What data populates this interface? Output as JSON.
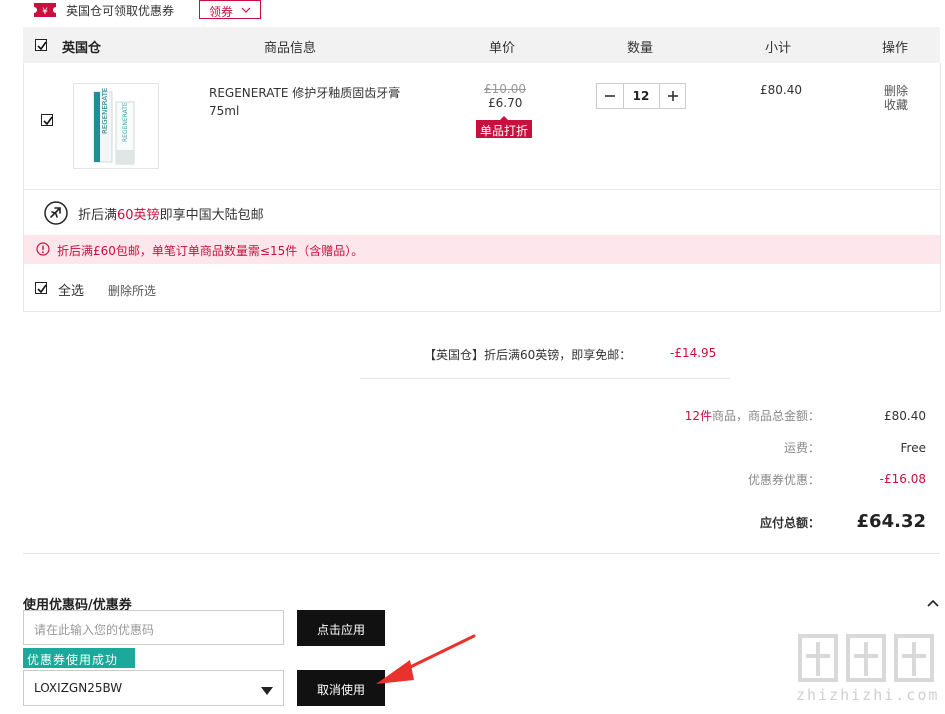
{
  "coupon_bar": {
    "text": "英国仓可领取优惠券",
    "claim_label": "领券",
    "chevron": "chevron-down-icon"
  },
  "table_header": {
    "warehouse": "英国仓",
    "columns": [
      "商品信息",
      "单价",
      "数量",
      "小计",
      "操作"
    ]
  },
  "item": {
    "name": "REGENERATE 修护牙釉质固齿牙膏 75ml",
    "original_price": "£10.00",
    "price": "£6.70",
    "discount_badge": "单品打折",
    "quantity": "12",
    "subtotal": "£80.40",
    "action_delete": "删除",
    "action_favorite": "收藏"
  },
  "shipping_promo": {
    "prefix": "折后满",
    "amount": "60英镑",
    "suffix": "即享中国大陆包邮"
  },
  "warning": "折后满£60包邮，单笔订单商品数量需≤15件（含赠品）。",
  "footer_actions": {
    "select_all": "全选",
    "delete_selected": "删除所选"
  },
  "discount_line": {
    "label": "【英国仓】折后满60英镑，即享免邮：",
    "value": "-£14.95"
  },
  "summary": {
    "count": "12件",
    "goods_label": "商品，商品总金额：",
    "goods_total": "£80.40",
    "shipping_label": "运费：",
    "shipping_value": "Free",
    "coupon_label": "优惠券优惠：",
    "coupon_value": "-£16.08",
    "payable_label": "应付总额：",
    "payable_value": "£64.32"
  },
  "coupon_section": {
    "title": "使用优惠码/优惠券",
    "input_placeholder": "请在此输入您的优惠码",
    "apply_label": "点击应用",
    "success_badge": "优惠券使用成功",
    "selected_code": "LOXIZGN25BW",
    "cancel_label": "取消使用"
  },
  "watermark": {
    "site": "zhizhizhi.com",
    "glyphs": "值值值"
  },
  "colors": {
    "accent": "#c8103e",
    "success": "#1aa99b",
    "warning_bg": "#fde7ec"
  }
}
